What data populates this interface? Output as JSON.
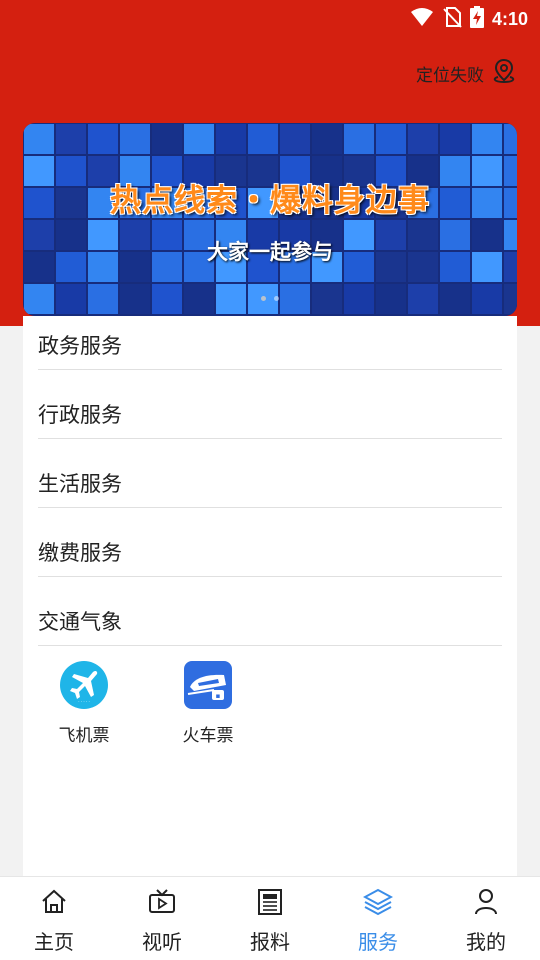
{
  "status_bar": {
    "time": "4:10"
  },
  "header": {
    "location_text": "定位失败"
  },
  "banner": {
    "title": "热点线索・爆料身边事",
    "subtitle": "大家一起参与",
    "page_count": 2,
    "active_page": 1
  },
  "sections": [
    {
      "label": "政务服务"
    },
    {
      "label": "行政服务"
    },
    {
      "label": "生活服务"
    },
    {
      "label": "缴费服务"
    },
    {
      "label": "交通气象"
    }
  ],
  "services": [
    {
      "label": "飞机票",
      "icon": "airplane-icon"
    },
    {
      "label": "火车票",
      "icon": "train-icon"
    }
  ],
  "bottom_nav": {
    "items": [
      {
        "label": "主页",
        "icon": "home-icon"
      },
      {
        "label": "视听",
        "icon": "tv-icon"
      },
      {
        "label": "报料",
        "icon": "newspaper-icon"
      },
      {
        "label": "服务",
        "icon": "layers-icon",
        "active": true
      },
      {
        "label": "我的",
        "icon": "user-icon"
      }
    ]
  },
  "colors": {
    "header_red": "#d42010",
    "active_blue": "#3a8de8",
    "airplane_bg": "#1fb5e8",
    "train_bg": "#2f6de0"
  }
}
